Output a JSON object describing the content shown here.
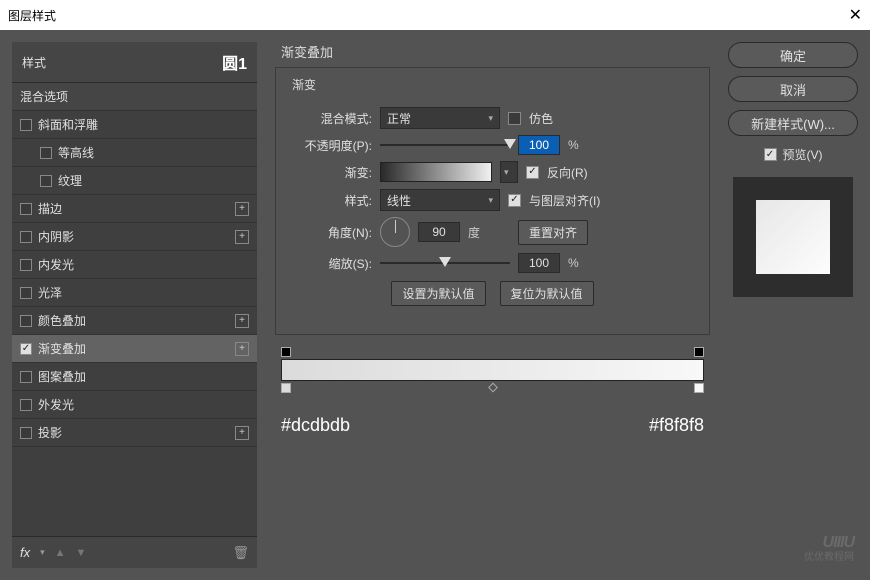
{
  "window": {
    "title": "图层样式"
  },
  "sidebar": {
    "header_label": "样式",
    "layer_name": "圆1",
    "items": [
      {
        "label": "混合选项",
        "type": "header"
      },
      {
        "label": "斜面和浮雕",
        "cb": false
      },
      {
        "label": "等高线",
        "cb": false,
        "sub": true
      },
      {
        "label": "纹理",
        "cb": false,
        "sub": true
      },
      {
        "label": "描边",
        "cb": false,
        "plus": true
      },
      {
        "label": "内阴影",
        "cb": false,
        "plus": true
      },
      {
        "label": "内发光",
        "cb": false
      },
      {
        "label": "光泽",
        "cb": false
      },
      {
        "label": "颜色叠加",
        "cb": false,
        "plus": true
      },
      {
        "label": "渐变叠加",
        "cb": true,
        "plus": true,
        "active": true
      },
      {
        "label": "图案叠加",
        "cb": false
      },
      {
        "label": "外发光",
        "cb": false
      },
      {
        "label": "投影",
        "cb": false,
        "plus": true
      }
    ],
    "footer": {
      "fx": "fx"
    }
  },
  "panel": {
    "title": "渐变叠加",
    "fieldset_title": "渐变",
    "blend_mode": {
      "label": "混合模式:",
      "value": "正常"
    },
    "dither": {
      "label": "仿色",
      "checked": false
    },
    "opacity": {
      "label": "不透明度(P):",
      "value": "100",
      "unit": "%"
    },
    "gradient": {
      "label": "渐变:"
    },
    "reverse": {
      "label": "反向(R)",
      "checked": true
    },
    "style": {
      "label": "样式:",
      "value": "线性"
    },
    "align": {
      "label": "与图层对齐(I)",
      "checked": true
    },
    "angle": {
      "label": "角度(N):",
      "value": "90",
      "unit": "度"
    },
    "reset_align": "重置对齐",
    "scale": {
      "label": "缩放(S):",
      "value": "100",
      "unit": "%"
    },
    "set_default": "设置为默认值",
    "reset_default": "复位为默认值",
    "color_left": "#dcdbdb",
    "color_right": "#f8f8f8"
  },
  "right": {
    "ok": "确定",
    "cancel": "取消",
    "new_style": "新建样式(W)...",
    "preview_label": "预览(V)",
    "preview_checked": true
  },
  "watermark": {
    "line1": "UIIIU",
    "line2": "优优教程网"
  }
}
